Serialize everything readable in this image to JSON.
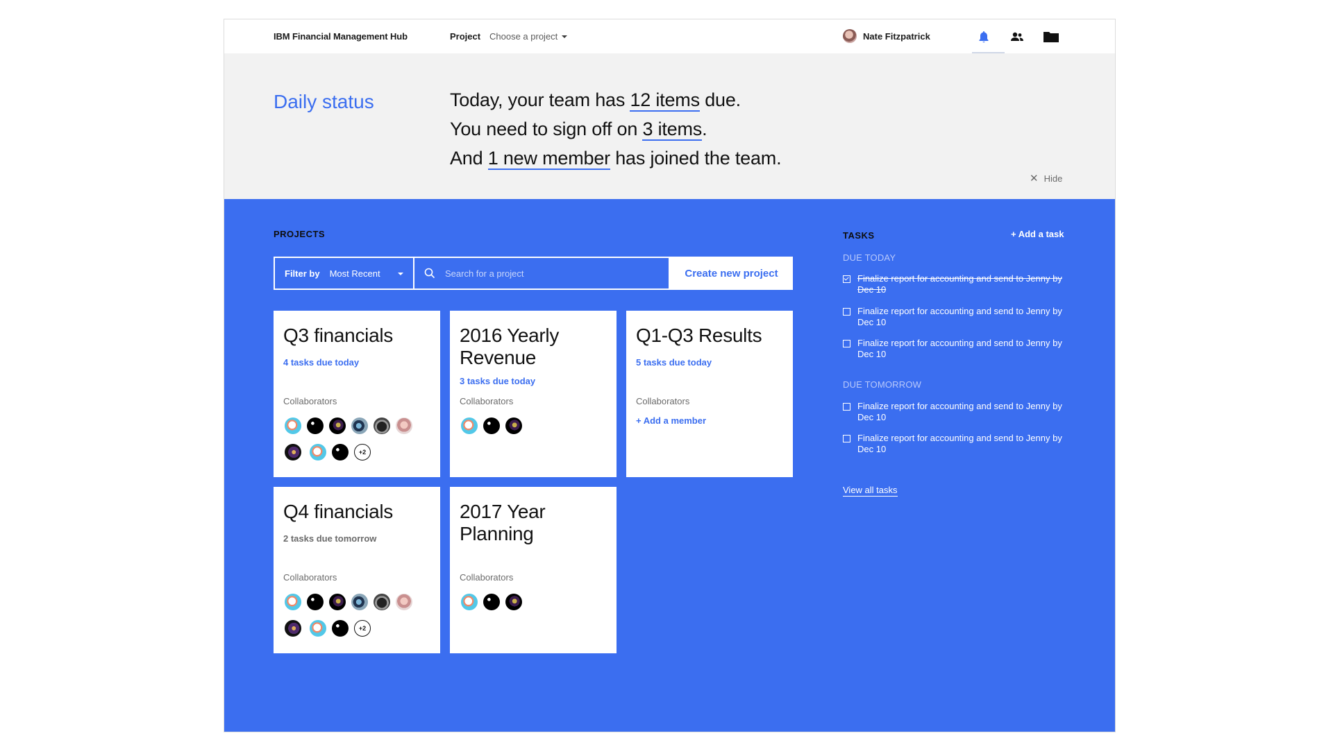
{
  "topnav": {
    "brand": "IBM Financial Management Hub",
    "project_label": "Project",
    "project_select": "Choose a project",
    "user_name": "Nate Fitzpatrick",
    "icons": [
      "bell-icon",
      "people-icon",
      "folder-icon"
    ]
  },
  "status": {
    "title": "Daily status",
    "line1_pre": "Today, your team has ",
    "line1_link": "12 items",
    "line1_post": " due.",
    "line2_pre": "You need to sign off on ",
    "line2_link": "3 items",
    "line2_post": ".",
    "line3_pre": "And ",
    "line3_link": "1 new member",
    "line3_post": " has joined the team.",
    "hide_label": "Hide"
  },
  "projects": {
    "title": "PROJECTS",
    "filter_label": "Filter by",
    "filter_value": "Most Recent",
    "search_placeholder": "Search for a project",
    "create_label": "Create new project",
    "collaborators_label": "Collaborators",
    "add_member_label": "+ Add a member",
    "more_count": "+2",
    "cards": [
      {
        "title": "Q3 financials",
        "due": "4 tasks due today"
      },
      {
        "title": "2016 Yearly Revenue",
        "due": "3 tasks due today"
      },
      {
        "title": "Q1-Q3 Results",
        "due": "5 tasks due today"
      },
      {
        "title": "Q4 financials",
        "due": "2 tasks due tomorrow"
      },
      {
        "title": "2017 Year Planning",
        "due": ""
      }
    ]
  },
  "tasks": {
    "title": "TASKS",
    "add_label": "+ Add a task",
    "due_today_label": "DUE TODAY",
    "due_tomorrow_label": "DUE TOMORROW",
    "today": [
      {
        "text": "Finalize report for accounting and send to Jenny by Dec 10",
        "done": true
      },
      {
        "text": "Finalize report for accounting and send to Jenny by Dec 10",
        "done": false
      },
      {
        "text": "Finalize report for accounting and send to Jenny by Dec 10",
        "done": false
      }
    ],
    "tomorrow": [
      {
        "text": "Finalize report for accounting and send to Jenny by Dec 10",
        "done": false
      },
      {
        "text": "Finalize report for accounting and send to Jenny by Dec 10",
        "done": false
      }
    ],
    "view_all_label": "View all tasks"
  },
  "colors": {
    "accent": "#3b6ef0",
    "banner_bg": "#f2f2f2",
    "card_bg": "#ffffff"
  }
}
